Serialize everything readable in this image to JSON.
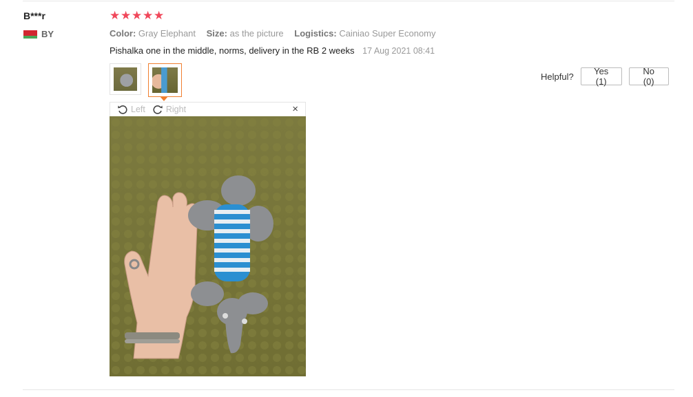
{
  "review": {
    "user_name": "B***r",
    "country_code": "BY",
    "rating_stars": 5,
    "attributes": [
      {
        "key": "Color:",
        "value": "Gray Elephant"
      },
      {
        "key": "Size:",
        "value": "as the picture"
      },
      {
        "key": "Logistics:",
        "value": "Cainiao Super Economy"
      }
    ],
    "feedback_text": "Pishalka one in the middle, norms, delivery in the RB 2 weeks",
    "date": "17 Aug 2021 08:41"
  },
  "helpful": {
    "label": "Helpful?",
    "yes_label": "Yes (1)",
    "no_label": "No (0)"
  },
  "viewer": {
    "rotate_left_label": "Left",
    "rotate_right_label": "Right",
    "close_glyph": "×"
  },
  "icons": {
    "star": "star-icon",
    "rotate_left": "rotate-left-icon",
    "rotate_right": "rotate-right-icon",
    "close": "close-icon"
  },
  "colors": {
    "star": "#f0475a",
    "thumb_selected_border": "#f07f2f",
    "flag_red": "#d22730",
    "flag_green": "#4aa657"
  }
}
